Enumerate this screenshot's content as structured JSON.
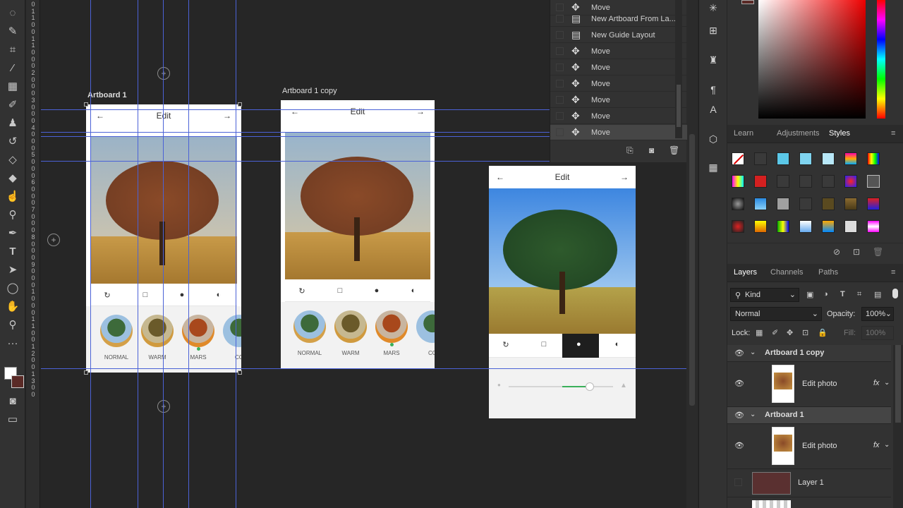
{
  "toolbar": {
    "icons": [
      "lasso-icon",
      "quick-select-icon",
      "crop-icon",
      "eyedropper-icon",
      "healing-brush-icon",
      "brush-icon",
      "stamp-icon",
      "history-brush-icon",
      "eraser-icon",
      "paint-bucket-icon",
      "smudge-icon",
      "dodge-icon",
      "pen-icon",
      "type-icon",
      "path-select-icon",
      "ellipse-icon",
      "hand-icon",
      "zoom-icon",
      "more-icon"
    ]
  },
  "ruler": {
    "marks": [
      "0",
      "1",
      "1",
      "0",
      "0",
      "1",
      "1",
      "0",
      "0",
      "0",
      "2",
      "0",
      "0",
      "0",
      "3",
      "0",
      "0",
      "0",
      "4",
      "0",
      "0",
      "0",
      "5",
      "0",
      "0",
      "0",
      "6",
      "0",
      "0",
      "0",
      "7",
      "0",
      "0",
      "0",
      "8",
      "0",
      "0",
      "0",
      "9",
      "0",
      "0",
      "0",
      "1",
      "0",
      "0",
      "0",
      "1",
      "1",
      "0",
      "0",
      "1",
      "2",
      "0",
      "0",
      "1",
      "3",
      "0",
      "0"
    ]
  },
  "artboards": [
    {
      "label": "Artboard 1",
      "edit_title": "Edit",
      "back": "←",
      "forward": "→",
      "filters": [
        "NORMAL",
        "WARM",
        "MARS",
        "CO"
      ]
    },
    {
      "label": "Artboard 1 copy",
      "edit_title": "Edit",
      "back": "←",
      "forward": "→",
      "filters": [
        "NORMAL",
        "WARM",
        "MARS",
        "CO"
      ]
    },
    {
      "label": "",
      "edit_title": "Edit",
      "back": "←",
      "forward": "→"
    }
  ],
  "history": {
    "items": [
      {
        "label": "Move",
        "icon": "move-icon"
      },
      {
        "label": "New Artboard From La...",
        "icon": "document-icon"
      },
      {
        "label": "New Guide Layout",
        "icon": "document-icon"
      },
      {
        "label": "Move",
        "icon": "move-icon"
      },
      {
        "label": "Move",
        "icon": "move-icon"
      },
      {
        "label": "Move",
        "icon": "move-icon"
      },
      {
        "label": "Move",
        "icon": "move-icon"
      },
      {
        "label": "Move",
        "icon": "move-icon"
      },
      {
        "label": "Move",
        "icon": "move-icon"
      }
    ]
  },
  "styles_tabs": {
    "learn": "Learn",
    "adjustments": "Adjustments",
    "styles": "Styles"
  },
  "layers_tabs": {
    "layers": "Layers",
    "channels": "Channels",
    "paths": "Paths"
  },
  "layers_panel": {
    "kind": "Kind",
    "blend_mode": "Normal",
    "opacity_label": "Opacity:",
    "opacity_value": "100%",
    "lock_label": "Lock:",
    "fill_label": "Fill:",
    "fill_value": "100%"
  },
  "layers": [
    {
      "name": "Artboard 1 copy",
      "type": "artboard"
    },
    {
      "name": "Edit photo",
      "type": "smart",
      "fx": "fx"
    },
    {
      "name": "Artboard 1",
      "type": "artboard"
    },
    {
      "name": "Edit photo",
      "type": "smart",
      "fx": "fx"
    },
    {
      "name": "Layer 1",
      "type": "pixel"
    }
  ],
  "colors": {
    "guide": "#4b62d6",
    "panel": "#323232",
    "canvas": "#262626"
  }
}
